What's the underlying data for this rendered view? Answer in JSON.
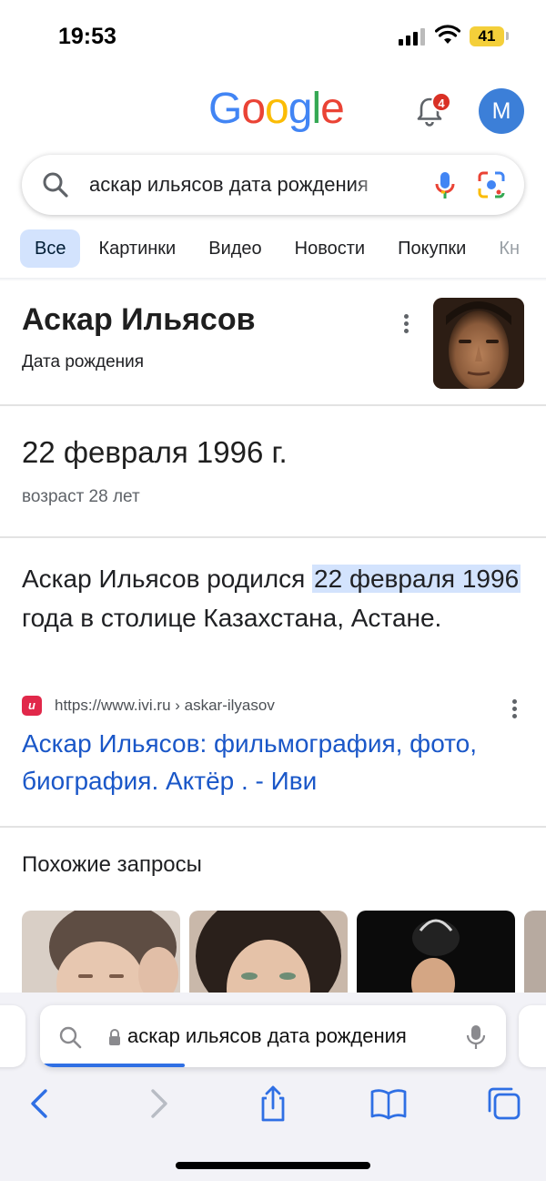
{
  "status_bar": {
    "time": "19:53",
    "battery": "41"
  },
  "header": {
    "logo": "Google",
    "notifications_count": "4",
    "avatar_initial": "M"
  },
  "search": {
    "query": "аскар ильясов дата рождения"
  },
  "tabs": [
    {
      "label": "Все",
      "active": true
    },
    {
      "label": "Картинки"
    },
    {
      "label": "Видео"
    },
    {
      "label": "Новости"
    },
    {
      "label": "Покупки"
    },
    {
      "label": "Кн"
    }
  ],
  "entity": {
    "title": "Аскар Ильясов",
    "subtitle": "Дата рождения"
  },
  "answer": {
    "date": "22 февраля 1996 г.",
    "age": "возраст 28 лет"
  },
  "snippet": {
    "before": "Аскар Ильясов родился ",
    "highlight": "22 февраля 1996",
    "after": " года в столице Казахстана, Астане."
  },
  "result": {
    "favicon": "и",
    "url": "https://www.ivi.ru › askar-ilyasov",
    "title": "Аскар Ильясов: фильмография, фото, биография. Актёр . - Иви"
  },
  "related": {
    "title": "Похожие запросы"
  },
  "safari": {
    "address_text": "аскар ильясов дата рождения",
    "load_progress": 0.31
  },
  "colors": {
    "accent_blue": "#1a57c8",
    "tab_active_bg": "#d3e3fd",
    "badge_red": "#d93025",
    "avatar_blue": "#3c7fd8"
  }
}
